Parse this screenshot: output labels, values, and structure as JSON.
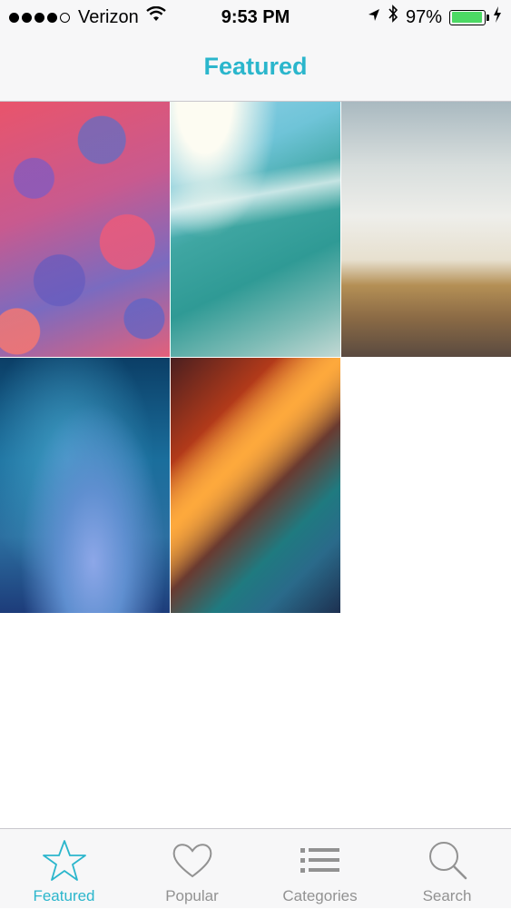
{
  "status_bar": {
    "carrier": "Verizon",
    "time": "9:53 PM",
    "battery": "97%",
    "battery_level": 0.97,
    "signal_dots_filled": 4,
    "signal_dots_total": 5,
    "battery_color": "#4cd964"
  },
  "nav": {
    "title": "Featured",
    "accent_color": "#2bb6cc"
  },
  "wallpapers": [
    {
      "name": "geometric-pink-blue-pattern"
    },
    {
      "name": "ocean-wave"
    },
    {
      "name": "hazy-sky-horizon"
    },
    {
      "name": "blue-purple-blur"
    },
    {
      "name": "orange-teal-streaks"
    }
  ],
  "tabs": [
    {
      "label": "Featured",
      "icon": "star-icon",
      "active": true
    },
    {
      "label": "Popular",
      "icon": "heart-icon",
      "active": false
    },
    {
      "label": "Categories",
      "icon": "list-icon",
      "active": false
    },
    {
      "label": "Search",
      "icon": "search-icon",
      "active": false
    }
  ]
}
